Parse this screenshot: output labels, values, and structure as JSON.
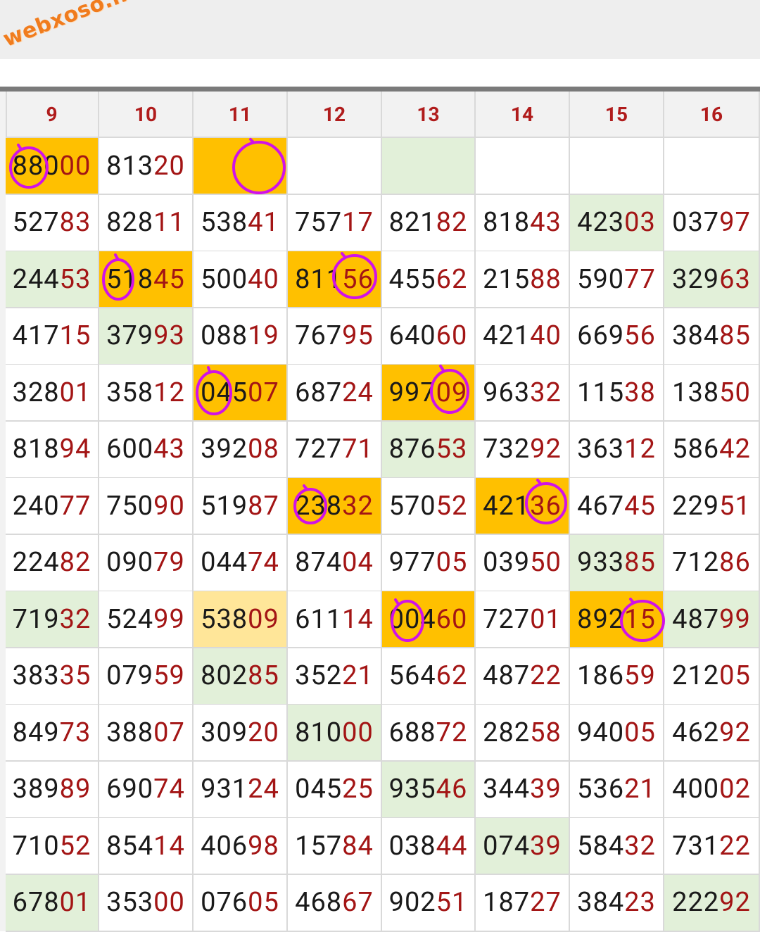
{
  "logo": "webxoso.net",
  "columns": [
    "9",
    "10",
    "11",
    "12",
    "13",
    "14",
    "15",
    "16"
  ],
  "rows": [
    [
      {
        "v": "88000",
        "bg": "orange"
      },
      {
        "v": "81320",
        "bg": "white"
      },
      {
        "v": "",
        "bg": "orange"
      },
      {
        "v": "",
        "bg": "white"
      },
      {
        "v": "",
        "bg": "green"
      },
      {
        "v": "",
        "bg": "white"
      },
      {
        "v": "",
        "bg": "white"
      },
      {
        "v": "",
        "bg": "white"
      }
    ],
    [
      {
        "v": "52783",
        "bg": "white"
      },
      {
        "v": "82811",
        "bg": "white"
      },
      {
        "v": "53841",
        "bg": "white"
      },
      {
        "v": "75717",
        "bg": "white"
      },
      {
        "v": "82182",
        "bg": "white"
      },
      {
        "v": "81843",
        "bg": "white"
      },
      {
        "v": "42303",
        "bg": "green"
      },
      {
        "v": "03797",
        "bg": "white"
      }
    ],
    [
      {
        "v": "24453",
        "bg": "green"
      },
      {
        "v": "51845",
        "bg": "orange"
      },
      {
        "v": "50040",
        "bg": "white"
      },
      {
        "v": "81156",
        "bg": "orange"
      },
      {
        "v": "45562",
        "bg": "white"
      },
      {
        "v": "21588",
        "bg": "white"
      },
      {
        "v": "59077",
        "bg": "white"
      },
      {
        "v": "32963",
        "bg": "green"
      }
    ],
    [
      {
        "v": "41715",
        "bg": "white"
      },
      {
        "v": "37993",
        "bg": "green"
      },
      {
        "v": "08819",
        "bg": "white"
      },
      {
        "v": "76795",
        "bg": "white"
      },
      {
        "v": "64060",
        "bg": "white"
      },
      {
        "v": "42140",
        "bg": "white"
      },
      {
        "v": "66956",
        "bg": "white"
      },
      {
        "v": "38485",
        "bg": "white"
      }
    ],
    [
      {
        "v": "32801",
        "bg": "white"
      },
      {
        "v": "35812",
        "bg": "white"
      },
      {
        "v": "04507",
        "bg": "orange"
      },
      {
        "v": "68724",
        "bg": "white"
      },
      {
        "v": "99709",
        "bg": "orange"
      },
      {
        "v": "96332",
        "bg": "white"
      },
      {
        "v": "11538",
        "bg": "white"
      },
      {
        "v": "13850",
        "bg": "white"
      }
    ],
    [
      {
        "v": "81894",
        "bg": "white"
      },
      {
        "v": "60043",
        "bg": "white"
      },
      {
        "v": "39208",
        "bg": "white"
      },
      {
        "v": "72771",
        "bg": "white"
      },
      {
        "v": "87653",
        "bg": "green"
      },
      {
        "v": "73292",
        "bg": "white"
      },
      {
        "v": "36312",
        "bg": "white"
      },
      {
        "v": "58642",
        "bg": "white"
      }
    ],
    [
      {
        "v": "24077",
        "bg": "white"
      },
      {
        "v": "75090",
        "bg": "white"
      },
      {
        "v": "51987",
        "bg": "white"
      },
      {
        "v": "23832",
        "bg": "orange"
      },
      {
        "v": "57052",
        "bg": "white"
      },
      {
        "v": "42136",
        "bg": "orange"
      },
      {
        "v": "46745",
        "bg": "white"
      },
      {
        "v": "22951",
        "bg": "white"
      }
    ],
    [
      {
        "v": "22482",
        "bg": "white"
      },
      {
        "v": "09079",
        "bg": "white"
      },
      {
        "v": "04474",
        "bg": "white"
      },
      {
        "v": "87404",
        "bg": "white"
      },
      {
        "v": "97705",
        "bg": "white"
      },
      {
        "v": "03950",
        "bg": "white"
      },
      {
        "v": "93385",
        "bg": "green"
      },
      {
        "v": "71286",
        "bg": "white"
      }
    ],
    [
      {
        "v": "71932",
        "bg": "green"
      },
      {
        "v": "52499",
        "bg": "white"
      },
      {
        "v": "53809",
        "bg": "paleorange"
      },
      {
        "v": "61114",
        "bg": "white"
      },
      {
        "v": "00460",
        "bg": "orange"
      },
      {
        "v": "72701",
        "bg": "white"
      },
      {
        "v": "89215",
        "bg": "orange"
      },
      {
        "v": "48799",
        "bg": "green"
      }
    ],
    [
      {
        "v": "38335",
        "bg": "white"
      },
      {
        "v": "07959",
        "bg": "white"
      },
      {
        "v": "80285",
        "bg": "green"
      },
      {
        "v": "35221",
        "bg": "white"
      },
      {
        "v": "56462",
        "bg": "white"
      },
      {
        "v": "48722",
        "bg": "white"
      },
      {
        "v": "18659",
        "bg": "white"
      },
      {
        "v": "21205",
        "bg": "white"
      }
    ],
    [
      {
        "v": "84973",
        "bg": "white"
      },
      {
        "v": "38807",
        "bg": "white"
      },
      {
        "v": "30920",
        "bg": "white"
      },
      {
        "v": "81000",
        "bg": "green"
      },
      {
        "v": "68872",
        "bg": "white"
      },
      {
        "v": "28258",
        "bg": "white"
      },
      {
        "v": "94005",
        "bg": "white"
      },
      {
        "v": "46292",
        "bg": "white"
      }
    ],
    [
      {
        "v": "38989",
        "bg": "white"
      },
      {
        "v": "69074",
        "bg": "white"
      },
      {
        "v": "93124",
        "bg": "white"
      },
      {
        "v": "04525",
        "bg": "white"
      },
      {
        "v": "93546",
        "bg": "green"
      },
      {
        "v": "34439",
        "bg": "white"
      },
      {
        "v": "53621",
        "bg": "white"
      },
      {
        "v": "40002",
        "bg": "white"
      }
    ],
    [
      {
        "v": "71052",
        "bg": "white"
      },
      {
        "v": "85414",
        "bg": "white"
      },
      {
        "v": "40698",
        "bg": "white"
      },
      {
        "v": "15784",
        "bg": "white"
      },
      {
        "v": "03844",
        "bg": "white"
      },
      {
        "v": "07439",
        "bg": "green"
      },
      {
        "v": "58432",
        "bg": "white"
      },
      {
        "v": "73122",
        "bg": "white"
      }
    ],
    [
      {
        "v": "67801",
        "bg": "green"
      },
      {
        "v": "35300",
        "bg": "white"
      },
      {
        "v": "07605",
        "bg": "white"
      },
      {
        "v": "46867",
        "bg": "white"
      },
      {
        "v": "90251",
        "bg": "white"
      },
      {
        "v": "18727",
        "bg": "white"
      },
      {
        "v": "38423",
        "bg": "white"
      },
      {
        "v": "22292",
        "bg": "green"
      }
    ]
  ],
  "colors": {
    "orange": "#ffc000",
    "green": "#e2f0d9",
    "paleorange": "#ffe699",
    "header_text": "#b01c1c",
    "suffix_text": "#a31515",
    "ink": "#d012e8"
  }
}
